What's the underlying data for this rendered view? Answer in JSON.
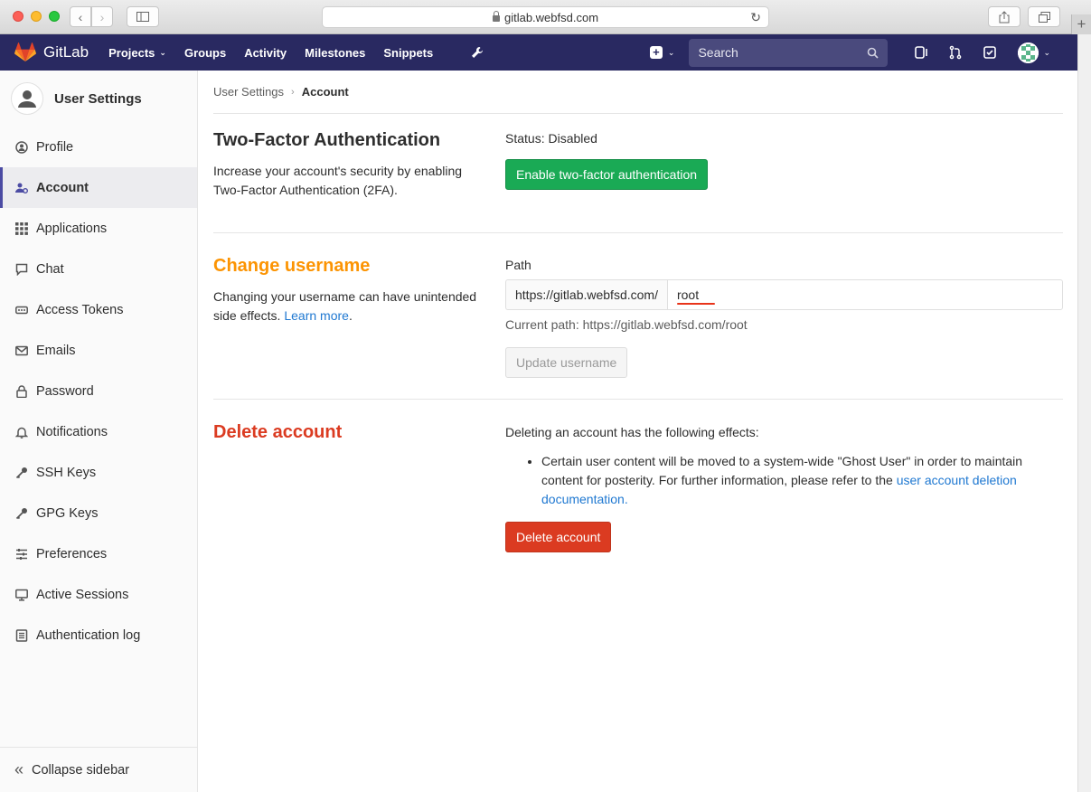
{
  "browser": {
    "url": "gitlab.webfsd.com"
  },
  "navbar": {
    "brand": "GitLab",
    "links": [
      "Projects",
      "Groups",
      "Activity",
      "Milestones",
      "Snippets"
    ],
    "search_placeholder": "Search",
    "accent": "#292961"
  },
  "sidebar": {
    "title": "User Settings",
    "items": [
      {
        "label": "Profile",
        "icon": "profile-icon"
      },
      {
        "label": "Account",
        "icon": "account-icon",
        "active": true
      },
      {
        "label": "Applications",
        "icon": "applications-icon"
      },
      {
        "label": "Chat",
        "icon": "chat-icon"
      },
      {
        "label": "Access Tokens",
        "icon": "token-icon"
      },
      {
        "label": "Emails",
        "icon": "email-icon"
      },
      {
        "label": "Password",
        "icon": "lock-icon"
      },
      {
        "label": "Notifications",
        "icon": "bell-icon"
      },
      {
        "label": "SSH Keys",
        "icon": "key-icon"
      },
      {
        "label": "GPG Keys",
        "icon": "key-icon"
      },
      {
        "label": "Preferences",
        "icon": "sliders-icon"
      },
      {
        "label": "Active Sessions",
        "icon": "monitor-icon"
      },
      {
        "label": "Authentication log",
        "icon": "log-icon"
      }
    ],
    "collapse_label": "Collapse sidebar"
  },
  "breadcrumb": {
    "parent": "User Settings",
    "current": "Account"
  },
  "two_factor": {
    "title": "Two-Factor Authentication",
    "description": "Increase your account's security by enabling Two-Factor Authentication (2FA).",
    "status": "Status: Disabled",
    "button": "Enable two-factor authentication"
  },
  "change_username": {
    "title": "Change username",
    "description": "Changing your username can have unintended side effects.",
    "learn_more": "Learn more",
    "path_label": "Path",
    "prefix": "https://gitlab.webfsd.com/",
    "value": "root",
    "current_path": "Current path: https://gitlab.webfsd.com/root",
    "button": "Update username",
    "title_color": "#fc9403"
  },
  "delete_account": {
    "title": "Delete account",
    "intro": "Deleting an account has the following effects:",
    "effect_text": "Certain user content will be moved to a system-wide \"Ghost User\" in order to maintain content for posterity. For further information, please refer to the",
    "effect_link": "user account deletion documentation.",
    "button": "Delete account",
    "title_color": "#db3b21"
  }
}
